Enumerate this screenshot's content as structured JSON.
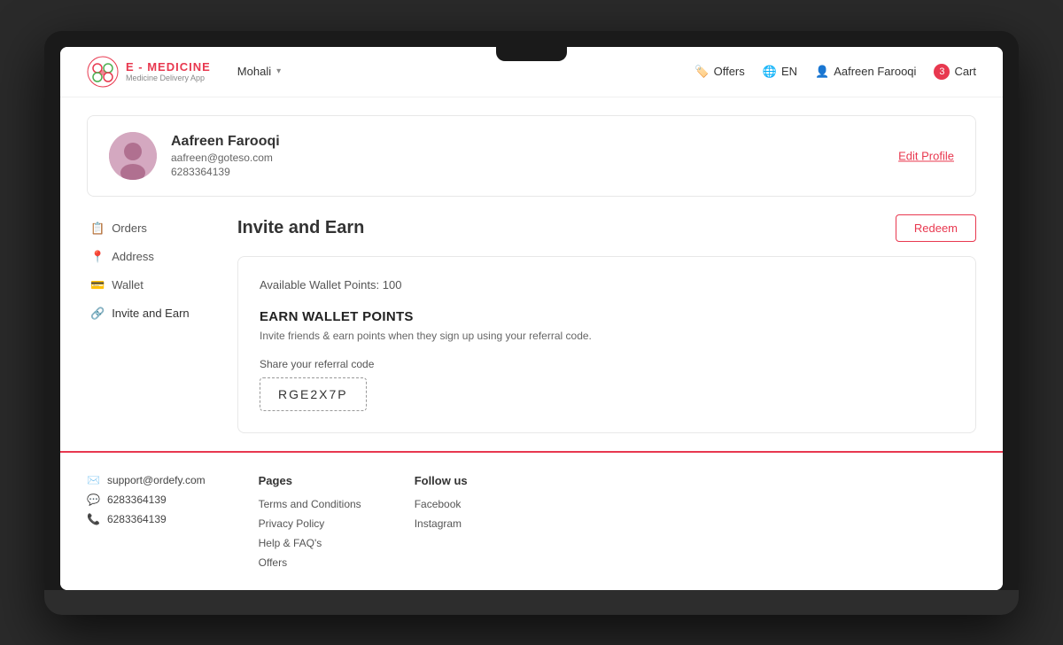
{
  "header": {
    "logo_title": "E - MEDICINE",
    "logo_subtitle": "Medicine Delivery App",
    "location": "Mohali",
    "offers_label": "Offers",
    "language_label": "EN",
    "user_name": "Aafreen Farooqi",
    "cart_label": "Cart",
    "cart_count": "3"
  },
  "profile": {
    "name": "Aafreen Farooqi",
    "email": "aafreen@goteso.com",
    "phone": "6283364139",
    "edit_label": "Edit Profile"
  },
  "sidebar": {
    "items": [
      {
        "id": "orders",
        "label": "Orders",
        "icon": "📋"
      },
      {
        "id": "address",
        "label": "Address",
        "icon": "📍"
      },
      {
        "id": "wallet",
        "label": "Wallet",
        "icon": "💳"
      },
      {
        "id": "invite-earn",
        "label": "Invite and Earn",
        "icon": "🔗"
      }
    ]
  },
  "invite_earn": {
    "page_title": "Invite and Earn",
    "redeem_label": "Redeem",
    "wallet_points_text": "Available Wallet Points: 100",
    "earn_title": "EARN WALLET POINTS",
    "earn_desc": "Invite friends & earn points when they sign up using your referral code.",
    "referral_label": "Share your referral code",
    "referral_code": "RGE2X7P"
  },
  "footer": {
    "email": "support@ordefy.com",
    "phone1": "6283364139",
    "phone2": "6283364139",
    "pages_title": "Pages",
    "pages_links": [
      "Terms and Conditions",
      "Privacy Policy",
      "Help & FAQ's",
      "Offers"
    ],
    "follow_title": "Follow us",
    "social_links": [
      "Facebook",
      "Instagram"
    ]
  }
}
